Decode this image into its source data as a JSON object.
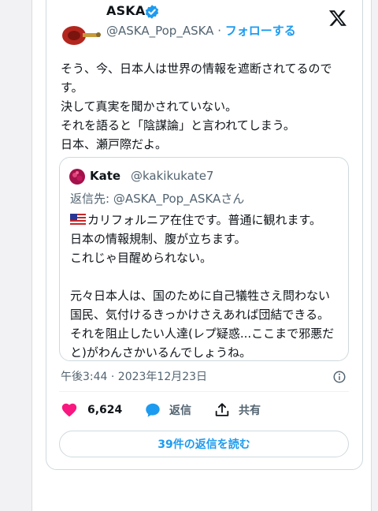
{
  "tweet": {
    "author_name": "ASKA",
    "handle": "@ASKA_Pop_ASKA",
    "separator": " · ",
    "follow_label": "フォローする",
    "text_lines": [
      "そう、今、日本人は世界の情報を遮断されてるので",
      "す。",
      "決して真実を聞かされていない。",
      "それを語ると「陰謀論」と言われてしまう。",
      "日本、瀬戸際だよ。"
    ],
    "timestamp": "午後3:44 · 2023年12月23日"
  },
  "quote": {
    "author_name": "Kate",
    "handle": "@kakikukate7",
    "reply_to": "返信先: @ASKA_Pop_ASKAさん",
    "lines": [
      "カリフォルニア在住です。普通に観れます。",
      "日本の情報規制、腹が立ちます。",
      "これじゃ目醒められない。",
      "",
      "元々日本人は、国のために自己犠牲さえ問わない",
      "国民、気付けるきっかけさえあれば団結できる。",
      "それを阻止したい人達(レプ疑惑...ここまで邪悪だ",
      "と)がわんさかいるんでしょうね。"
    ]
  },
  "actions": {
    "like_count": "6,624",
    "reply_label": "返信",
    "share_label": "共有",
    "read_replies_label": "39件の返信を読む"
  },
  "icons": {
    "verified": "verified-badge-icon",
    "x_logo": "x-logo-icon",
    "info": "info-icon",
    "like": "heart-icon",
    "reply": "speech-bubble-icon",
    "share": "share-upload-icon",
    "flag": "us-flag-icon"
  },
  "colors": {
    "accent": "#1d9bf0",
    "like": "#f91880",
    "secondary_text": "#536471",
    "border": "#cfd9de"
  }
}
